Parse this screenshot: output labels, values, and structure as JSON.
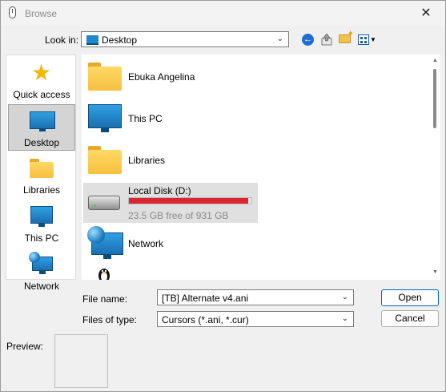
{
  "window": {
    "title": "Browse",
    "close_glyph": "✕"
  },
  "lookin": {
    "label": "Look in:",
    "value": "Desktop"
  },
  "toolbar": {
    "back_icon": "back-arrow-icon",
    "up_icon": "up-folder-icon",
    "new_folder_icon": "new-folder-icon",
    "view_icon": "view-menu-icon"
  },
  "places": [
    {
      "label": "Quick access",
      "icon": "star-icon"
    },
    {
      "label": "Desktop",
      "icon": "desktop-icon",
      "selected": true
    },
    {
      "label": "Libraries",
      "icon": "libraries-folder-icon"
    },
    {
      "label": "This PC",
      "icon": "monitor-icon"
    },
    {
      "label": "Network",
      "icon": "network-icon"
    }
  ],
  "files": [
    {
      "name": "Ebuka Angelina",
      "icon": "folder-icon"
    },
    {
      "name": "This PC",
      "icon": "monitor-icon"
    },
    {
      "name": "Libraries",
      "icon": "folder-icon"
    },
    {
      "name": "Local Disk (D:)",
      "icon": "drive-icon",
      "free_text": "23.5 GB free of 931 GB",
      "used_fraction": 0.975,
      "selected": true
    },
    {
      "name": "Network",
      "icon": "network-icon"
    }
  ],
  "form": {
    "filename_label": "File name:",
    "filename_value": "[TB] Alternate v4.ani",
    "filetype_label": "Files of type:",
    "filetype_value": "Cursors (*.ani, *.cur)",
    "open_label": "Open",
    "cancel_label": "Cancel",
    "preview_label": "Preview:"
  },
  "colors": {
    "disk_bar": "#da2630",
    "accent": "#0067c0"
  }
}
